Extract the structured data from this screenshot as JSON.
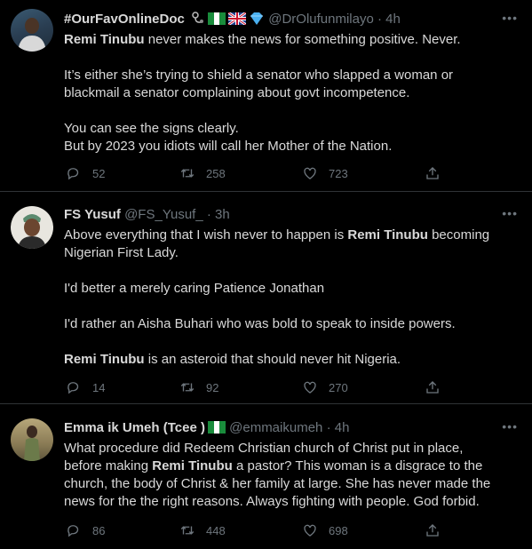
{
  "tweets": [
    {
      "name": "#OurFavOnlineDoc",
      "handle": "@DrOlufunmilayo",
      "sep": "·",
      "time": "4h",
      "emoji_icons": [
        "stethoscope-icon",
        "nigeria-flag-icon",
        "uk-flag-icon",
        "blue-diamond-icon"
      ],
      "lines": [
        [
          "Remi Tinubu",
          " never makes the news for something positive. Never."
        ],
        [
          ""
        ],
        [
          "",
          "It’s either she’s trying to shield a senator who slapped a woman or"
        ],
        [
          "",
          "blackmail a senator complaining about govt incompetence."
        ],
        [
          ""
        ],
        [
          "",
          "You can see the signs clearly."
        ],
        [
          "",
          "But by 2023 you idiots will call her Mother of the Nation."
        ]
      ],
      "replies": "52",
      "retweets": "258",
      "likes": "723"
    },
    {
      "name": "FS Yusuf",
      "handle": "@FS_Yusuf_",
      "sep": "·",
      "time": "3h",
      "lines": [
        [
          "",
          "Above everything that I wish never to happen is ",
          "Remi Tinubu",
          " becoming"
        ],
        [
          "",
          "Nigerian First Lady."
        ],
        [
          ""
        ],
        [
          "",
          "I'd better a merely caring Patience Jonathan"
        ],
        [
          ""
        ],
        [
          "",
          "I'd rather an Aisha Buhari who was bold to speak to inside powers."
        ],
        [
          ""
        ],
        [
          "Remi Tinubu",
          " is an asteroid that should never hit Nigeria."
        ]
      ],
      "replies": "14",
      "retweets": "92",
      "likes": "270"
    },
    {
      "name": "Emma ik Umeh (Tcee )",
      "handle": "@emmaikumeh",
      "sep": "·",
      "time": "4h",
      "emoji_icons": [
        "nigeria-flag-icon"
      ],
      "lines": [
        [
          "",
          "What procedure did Redeem Christian church of Christ put in place,"
        ],
        [
          "",
          "before making ",
          "Remi Tinubu",
          " a pastor? This woman is a disgrace to the"
        ],
        [
          "",
          "church, the body of Christ & her family at large. She has never made the"
        ],
        [
          "",
          "news for the the right reasons. Always fighting with people. God forbid."
        ]
      ],
      "replies": "86",
      "retweets": "448",
      "likes": "698"
    }
  ],
  "more_label": "•••",
  "colors": {
    "background": "#000000",
    "text": "#d9d9d9",
    "muted": "#6e767d",
    "divider": "#2f3336"
  }
}
